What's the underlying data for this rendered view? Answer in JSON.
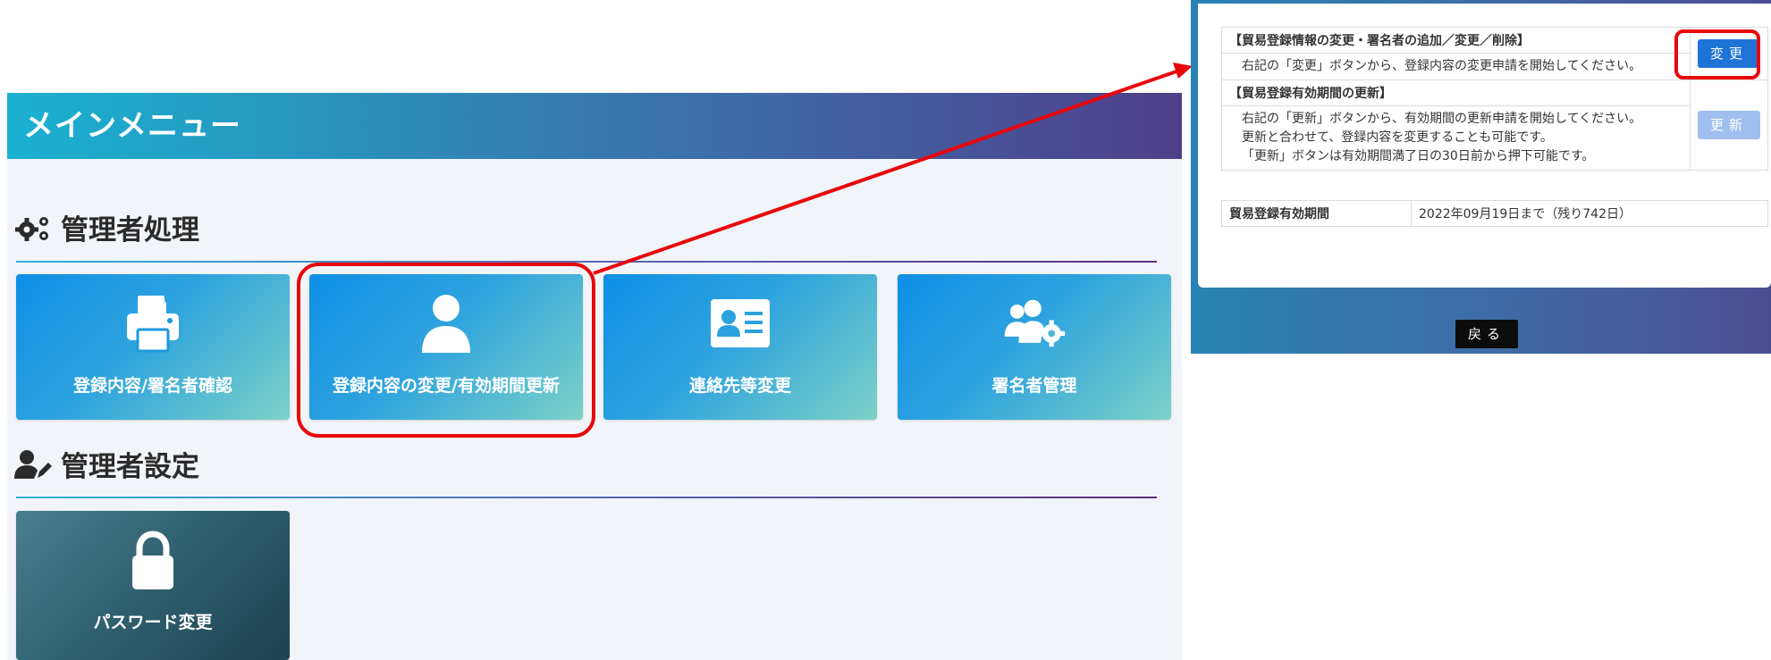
{
  "main": {
    "title": "メインメニュー",
    "section_admin_process": {
      "title": "管理者処理",
      "icon": "gears-icon"
    },
    "section_admin_settings": {
      "title": "管理者設定",
      "icon": "user-edit-icon"
    },
    "tiles": [
      {
        "label": "登録内容/署名者確認",
        "icon": "printer-icon"
      },
      {
        "label": "登録内容の変更/有効期間更新",
        "icon": "user-icon"
      },
      {
        "label": "連絡先等変更",
        "icon": "id-card-icon"
      },
      {
        "label": "署名者管理",
        "icon": "users-gear-icon"
      },
      {
        "label": "パスワード変更",
        "icon": "lock-icon"
      }
    ]
  },
  "modal": {
    "change_heading": "【貿易登録情報の変更・署名者の追加／変更／削除】",
    "change_desc": "右記の「変更」ボタンから、登録内容の変更申請を開始してください。",
    "change_button": "変更",
    "renew_heading": "【貿易登録有効期間の更新】",
    "renew_desc_lines": [
      "右記の「更新」ボタンから、有効期間の更新申請を開始してください。",
      "更新と合わせて、登録内容を変更することも可能です。",
      "「更新」ボタンは有効期間満了日の30日前から押下可能です。"
    ],
    "renew_button": "更新",
    "validity_label": "貿易登録有効期間",
    "validity_value": "2022年09月19日まで（残り742日）",
    "back_button": "戻る"
  },
  "colors": {
    "highlight": "#e8070c",
    "tile_gradient_start": "#0e8fe6",
    "tile_gradient_end": "#7dd1c7",
    "primary_button": "#1f73d6"
  }
}
